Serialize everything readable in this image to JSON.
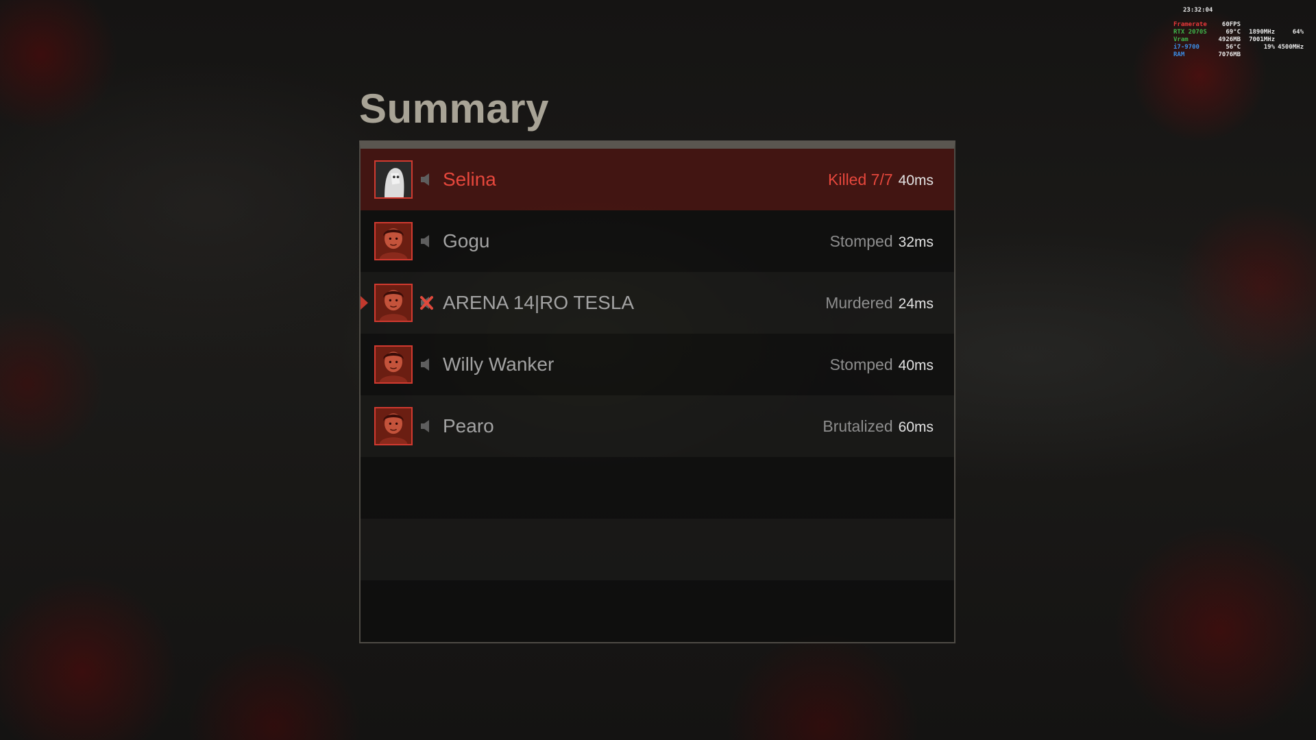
{
  "overlay": {
    "time": "23:32:04",
    "rows": [
      {
        "label": "Framerate",
        "color": "#e8383a",
        "v1": "60FPS",
        "v2": "",
        "v3": ""
      },
      {
        "label": "RTX 2070S",
        "color": "#3fb34a",
        "v1": "69°C",
        "v2": "1890MHz",
        "v3": "64%"
      },
      {
        "label": "Vram",
        "color": "#3fb34a",
        "v1": "4926MB",
        "v2": "7001MHz",
        "v3": ""
      },
      {
        "label": "i7-9700",
        "color": "#3b8ee8",
        "v1": "56°C",
        "v2": "19%",
        "v3": "4500MHz"
      },
      {
        "label": "RAM",
        "color": "#3b8ee8",
        "v1": "7076MB",
        "v2": "",
        "v3": ""
      }
    ]
  },
  "title": "Summary",
  "players": [
    {
      "name": "Selina",
      "status": "Killed 7/7",
      "ping": "40ms",
      "highlight": true,
      "avatar": "counselor-masked",
      "voice": "speaker-icon",
      "marker": false
    },
    {
      "name": "Gogu",
      "status": "Stomped",
      "ping": "32ms",
      "highlight": false,
      "avatar": "counselor-portrait",
      "voice": "speaker-icon",
      "marker": false
    },
    {
      "name": "ARENA 14|RO TESLA",
      "status": "Murdered",
      "ping": "24ms",
      "highlight": false,
      "avatar": "counselor-portrait",
      "voice": "muted-x-icon",
      "marker": true
    },
    {
      "name": "Willy Wanker",
      "status": "Stomped",
      "ping": "40ms",
      "highlight": false,
      "avatar": "counselor-portrait",
      "voice": "speaker-icon",
      "marker": false
    },
    {
      "name": "Pearo",
      "status": "Brutalized",
      "ping": "60ms",
      "highlight": false,
      "avatar": "counselor-portrait",
      "voice": "speaker-icon",
      "marker": false
    }
  ],
  "colors": {
    "accent": "#e6473c",
    "avatar_border": "#d23a30",
    "title": "#a8a396"
  }
}
